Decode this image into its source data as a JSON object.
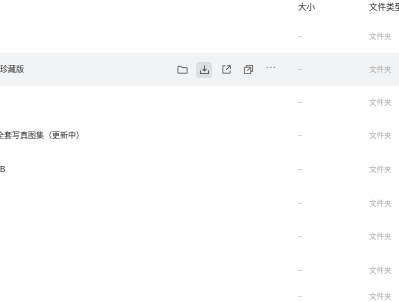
{
  "columns": {
    "size": "大小",
    "type": "文件类型"
  },
  "rows": [
    {
      "name": "",
      "size": "–",
      "type": "文件夹"
    },
    {
      "name": "珍藏版",
      "size": "–",
      "type": "文件夹"
    },
    {
      "name": "",
      "size": "–",
      "type": "文件夹"
    },
    {
      "name": "全套写真图集（更新中）",
      "size": "–",
      "type": "文件夹"
    },
    {
      "name": "B",
      "size": "–",
      "type": "文件夹"
    },
    {
      "name": "",
      "size": "–",
      "type": "文件夹"
    },
    {
      "name": "",
      "size": "–",
      "type": "文件夹"
    },
    {
      "name": "",
      "size": "–",
      "type": "文件夹"
    },
    {
      "name": "",
      "size": "–",
      "type": "文件夹"
    }
  ],
  "hover_actions": {
    "more": "···"
  },
  "icons": {
    "open": "folder-icon",
    "download": "download-icon",
    "share": "share-icon",
    "move": "move-icon",
    "more": "more-icon"
  },
  "colors": {
    "hover_row": "#f2f3f5",
    "active_button": "#dcdfe4",
    "muted_text": "#a8a8a8"
  }
}
